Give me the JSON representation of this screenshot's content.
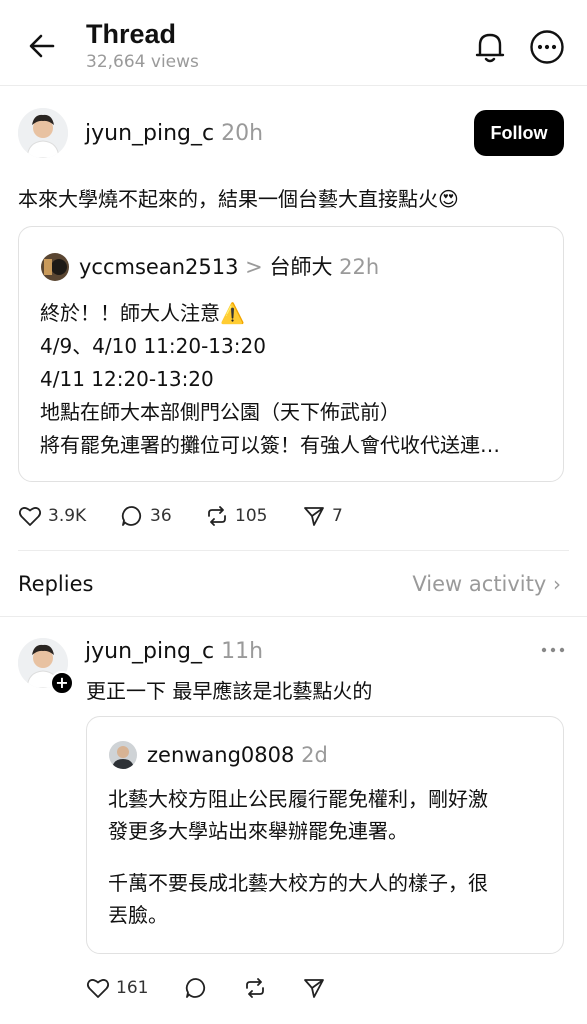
{
  "header": {
    "title": "Thread",
    "views": "32,664 views"
  },
  "post": {
    "author": "jyun_ping_c",
    "time": "20h",
    "follow_label": "Follow",
    "text": "本來大學燒不起來的，結果一個台藝大直接點火😍",
    "quote": {
      "author": "yccmsean2513",
      "separator": ">",
      "topic": "台師大",
      "time": "22h",
      "lines": [
        "終於！！師大人注意⚠️",
        "4/9、4/10 11:20-13:20",
        "4/11 12:20-13:20",
        "地點在師大本部側門公園（天下佈武前）",
        "將有罷免連署的攤位可以簽！有強人會代收代送連…"
      ]
    },
    "stats": {
      "likes": "3.9K",
      "comments": "36",
      "reposts": "105",
      "shares": "7"
    }
  },
  "replies_section": {
    "label": "Replies",
    "view_activity": "View activity"
  },
  "reply": {
    "author": "jyun_ping_c",
    "time": "11h",
    "text": "更正一下 最早應該是北藝點火的",
    "quote": {
      "author": "zenwang0808",
      "time": "2d",
      "lines": [
        "北藝大校方阻止公民履行罷免權利，剛好激",
        "發更多大學站出來舉辦罷免連署。",
        "千萬不要長成北藝大校方的大人的樣子，很",
        "丟臉。"
      ]
    },
    "stats": {
      "likes": "161"
    }
  }
}
